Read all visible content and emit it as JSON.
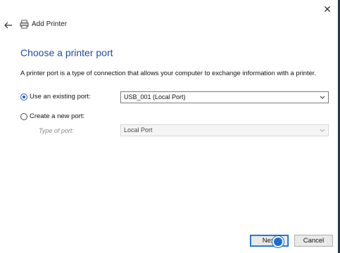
{
  "window": {
    "close_glyph": "✕",
    "back_icon": "back-arrow-icon",
    "header_title": "Add Printer",
    "header_icon": "printer-icon"
  },
  "page": {
    "title": "Choose a printer port",
    "description": "A printer port is a type of connection that allows your computer to exchange information with a printer."
  },
  "options": {
    "existing": {
      "label": "Use an existing port:",
      "selected": true,
      "value": "USB_001 (Local Port)"
    },
    "create": {
      "label": "Create a new port:",
      "selected": false,
      "type_label": "Type of port:",
      "type_value": "Local Port"
    }
  },
  "buttons": {
    "next": "Next",
    "cancel": "Cancel"
  },
  "colors": {
    "accent": "#1a5fb4",
    "title": "#1f4e9b"
  }
}
